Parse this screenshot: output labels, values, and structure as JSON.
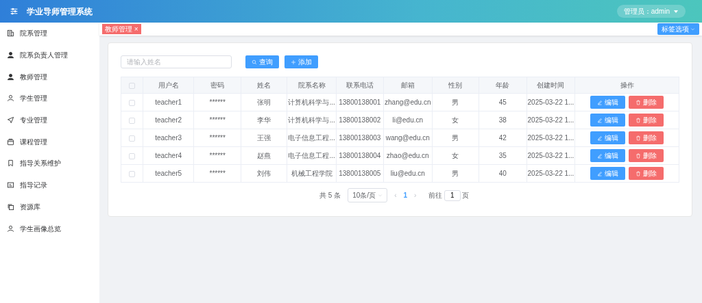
{
  "header": {
    "title": "学业导师管理系统",
    "user_menu": "管理员：admin"
  },
  "sidebar": {
    "items": [
      {
        "label": "院系管理",
        "selected": false
      },
      {
        "label": "院系负责人管理",
        "selected": false
      },
      {
        "label": "教师管理",
        "selected": false
      },
      {
        "label": "学生管理",
        "selected": false
      },
      {
        "label": "专业管理",
        "selected": false
      },
      {
        "label": "课程管理",
        "selected": false
      },
      {
        "label": "指导关系维护",
        "selected": false
      },
      {
        "label": "指导记录",
        "selected": false
      },
      {
        "label": "资源库",
        "selected": false
      },
      {
        "label": "学生画像总览",
        "selected": false
      }
    ]
  },
  "tags": [
    {
      "label": "教师管理",
      "close": "×",
      "selected": true
    }
  ],
  "tag_options": "标签选项",
  "search": {
    "placeholder": "请输入姓名"
  },
  "buttons": [
    {
      "label": "查询"
    },
    {
      "label": "添加"
    }
  ],
  "table": {
    "select_all_checked": false,
    "columns": [
      "用户名",
      "密码",
      "姓名",
      "院系名称",
      "联系电话",
      "邮箱",
      "性别",
      "年龄",
      "创建时间",
      "操作"
    ],
    "rows": [
      {
        "checked": false,
        "cells": [
          "teacher1",
          "******",
          "张明",
          "计算机科学与...",
          "13800138001",
          "zhang@edu.cn",
          "男",
          "45",
          "2025-03-22 1..."
        ],
        "actions": [
          "编辑",
          "删除"
        ]
      },
      {
        "checked": false,
        "cells": [
          "teacher2",
          "******",
          "李华",
          "计算机科学与...",
          "13800138002",
          "li@edu.cn",
          "女",
          "38",
          "2025-03-22 1..."
        ],
        "actions": [
          "编辑",
          "删除"
        ]
      },
      {
        "checked": false,
        "cells": [
          "teacher3",
          "******",
          "王强",
          "电子信息工程...",
          "13800138003",
          "wang@edu.cn",
          "男",
          "42",
          "2025-03-22 1..."
        ],
        "actions": [
          "编辑",
          "删除"
        ]
      },
      {
        "checked": false,
        "cells": [
          "teacher4",
          "******",
          "赵燕",
          "电子信息工程...",
          "13800138004",
          "zhao@edu.cn",
          "女",
          "35",
          "2025-03-22 1..."
        ],
        "actions": [
          "编辑",
          "删除"
        ]
      },
      {
        "checked": false,
        "cells": [
          "teacher5",
          "******",
          "刘伟",
          "机械工程学院",
          "13800138005",
          "liu@edu.cn",
          "男",
          "40",
          "2025-03-22 1..."
        ],
        "actions": [
          "编辑",
          "删除"
        ]
      }
    ]
  },
  "pagination": {
    "total": "共 5 条",
    "page_size": "10条/页",
    "prev": "‹",
    "pages": [
      {
        "label": "1",
        "selected": true
      }
    ],
    "next": "›",
    "goto_label": "前往",
    "goto_value": "1",
    "goto_suffix": "页"
  }
}
